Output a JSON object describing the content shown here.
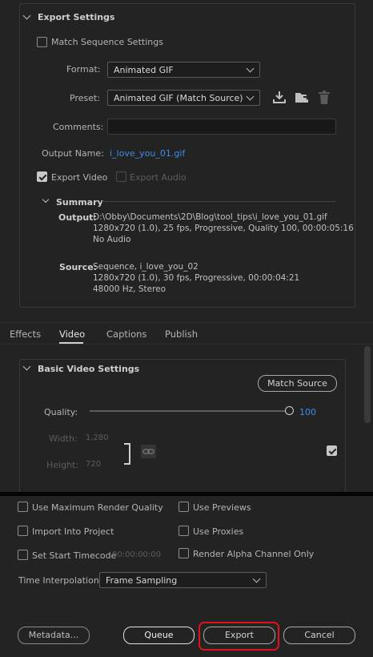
{
  "export_settings": {
    "title": "Export Settings",
    "match_sequence_label": "Match Sequence Settings",
    "format_label": "Format:",
    "format_value": "Animated GIF",
    "preset_label": "Preset:",
    "preset_value": "Animated GIF (Match Source)",
    "comments_label": "Comments:",
    "comments_value": "",
    "output_name_label": "Output Name:",
    "output_name_value": "i_love_you_01.gif",
    "export_video_label": "Export Video",
    "export_audio_label": "Export Audio"
  },
  "summary": {
    "title": "Summary",
    "output_label": "Output:",
    "output_lines": [
      "D:\\Obby\\Documents\\2D\\Blog\\tool_tips\\i_love_you_01.gif",
      "1280x720 (1.0), 25 fps, Progressive, Quality 100, 00:00:05:16",
      "No Audio"
    ],
    "source_label": "Source:",
    "source_lines": [
      "Sequence, i_love_you_02",
      "1280x720 (1.0), 30 fps, Progressive, 00:00:04:21",
      "48000 Hz, Stereo"
    ]
  },
  "tabs": [
    "Effects",
    "Video",
    "Captions",
    "Publish"
  ],
  "active_tab": "Video",
  "basic_video": {
    "title": "Basic Video Settings",
    "match_source_label": "Match Source",
    "quality_label": "Quality:",
    "quality_value": "100",
    "quality_fraction": 1.0,
    "width_label": "Width:",
    "width_value": "1,280",
    "height_label": "Height:",
    "height_value": "720"
  },
  "bottom_options": {
    "max_render_quality": "Use Maximum Render Quality",
    "use_previews": "Use Previews",
    "import_into_project": "Import Into Project",
    "use_proxies": "Use Proxies",
    "set_start_timecode": "Set Start Timecode",
    "start_timecode_value": "00:00:00:00",
    "render_alpha": "Render Alpha Channel Only",
    "time_interp_label": "Time Interpolation:",
    "time_interp_value": "Frame Sampling"
  },
  "buttons": {
    "metadata": "Metadata...",
    "queue": "Queue",
    "export": "Export",
    "cancel": "Cancel"
  },
  "colors": {
    "accent_link": "#3a8ee6",
    "highlight_red": "#e0101c"
  }
}
